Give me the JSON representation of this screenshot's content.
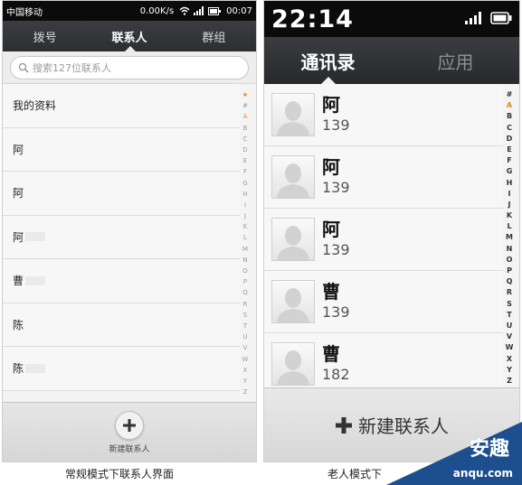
{
  "left": {
    "status": {
      "carrier": "中国移动",
      "speed": "0.00K/s",
      "time": "00:07"
    },
    "tabs": [
      {
        "label": "拨号",
        "active": false
      },
      {
        "label": "联系人",
        "active": true
      },
      {
        "label": "群组",
        "active": false
      }
    ],
    "search_placeholder": "搜索127位联系人",
    "contacts": [
      {
        "name": "我的资料"
      },
      {
        "name": "阿"
      },
      {
        "name": "阿"
      },
      {
        "name": "阿"
      },
      {
        "name": "曹"
      },
      {
        "name": "陈"
      },
      {
        "name": "陈"
      }
    ],
    "index": [
      "★",
      "#",
      "A",
      "B",
      "C",
      "D",
      "E",
      "F",
      "G",
      "H",
      "I",
      "J",
      "K",
      "L",
      "M",
      "N",
      "O",
      "P",
      "Q",
      "R",
      "S",
      "T",
      "U",
      "V",
      "W",
      "X",
      "Y",
      "Z"
    ],
    "new_contact_label": "新建联系人",
    "caption": "常规模式下联系人界面"
  },
  "right": {
    "status": {
      "time": "22:14"
    },
    "tabs": [
      {
        "label": "通讯录",
        "active": true
      },
      {
        "label": "应用",
        "active": false
      }
    ],
    "contacts": [
      {
        "name": "阿",
        "phone": "139"
      },
      {
        "name": "阿",
        "phone": "139"
      },
      {
        "name": "阿",
        "phone": "139"
      },
      {
        "name": "曹",
        "phone": "139"
      },
      {
        "name": "曹",
        "phone": "182"
      }
    ],
    "index": [
      "#",
      "A",
      "B",
      "C",
      "D",
      "E",
      "F",
      "G",
      "H",
      "I",
      "J",
      "K",
      "L",
      "M",
      "N",
      "O",
      "P",
      "Q",
      "R",
      "S",
      "T",
      "U",
      "V",
      "W",
      "X",
      "Y",
      "Z"
    ],
    "new_contact_label": "新建联系人",
    "caption": "老人模式下"
  },
  "watermark": {
    "text": "安趣",
    "url": "anqu.com"
  },
  "colors": {
    "accent": "#e88a1a",
    "bar_dark": "#2c2e31",
    "watermark": "#1d4f8f"
  }
}
